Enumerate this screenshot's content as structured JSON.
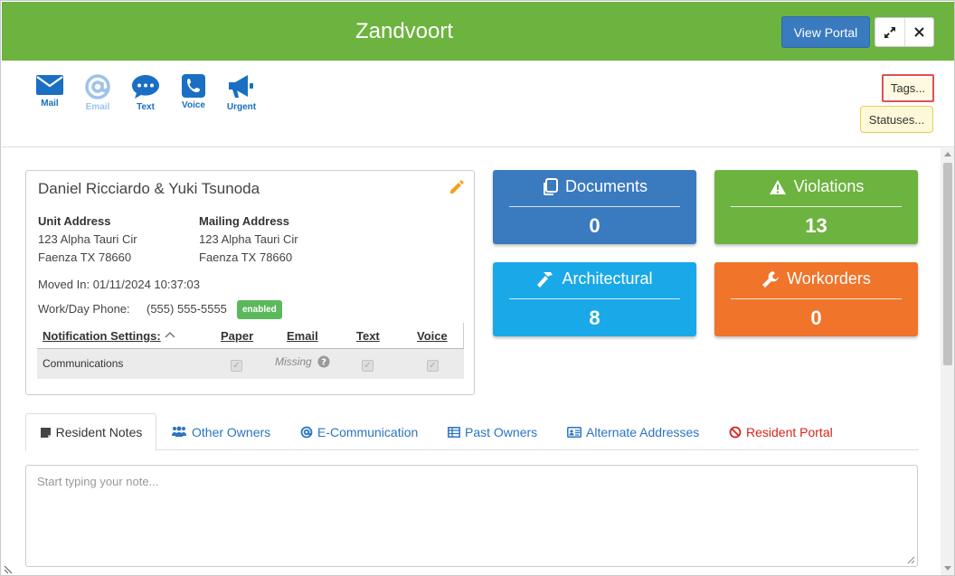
{
  "header": {
    "title": "Zandvoort",
    "view_portal_label": "View Portal"
  },
  "toolbar": {
    "items": [
      {
        "label": "Mail",
        "icon": "envelope-icon"
      },
      {
        "label": "Email",
        "icon": "at-icon"
      },
      {
        "label": "Text",
        "icon": "chat-bubble-icon"
      },
      {
        "label": "Voice",
        "icon": "phone-icon"
      },
      {
        "label": "Urgent",
        "icon": "megaphone-icon"
      }
    ],
    "tags_label": "Tags...",
    "statuses_label": "Statuses..."
  },
  "owner": {
    "name": "Daniel Ricciardo & Yuki Tsunoda",
    "unit_address_label": "Unit Address",
    "unit_address_line1": "123 Alpha Tauri Cir",
    "unit_address_line2": "Faenza TX 78660",
    "mailing_address_label": "Mailing Address",
    "mailing_address_line1": "123 Alpha Tauri Cir",
    "mailing_address_line2": "Faenza TX 78660",
    "moved_in": "Moved In: 01/11/2024 10:37:03",
    "phone_label": "Work/Day Phone:",
    "phone_value": "(555) 555-5555",
    "phone_badge": "enabled"
  },
  "notifications": {
    "header": "Notification Settings:",
    "columns": [
      "Paper",
      "Email",
      "Text",
      "Voice"
    ],
    "row_label": "Communications",
    "email_status": "Missing",
    "checkmark": "✓"
  },
  "tiles": {
    "documents": {
      "label": "Documents",
      "value": "0",
      "color": "#3a7abf"
    },
    "violations": {
      "label": "Violations",
      "value": "13",
      "color": "#6db33f"
    },
    "architectural": {
      "label": "Architectural",
      "value": "8",
      "color": "#1aa9e8"
    },
    "workorders": {
      "label": "Workorders",
      "value": "0",
      "color": "#f0742a"
    }
  },
  "tabs": [
    {
      "label": "Resident Notes",
      "icon": "note-icon"
    },
    {
      "label": "Other Owners",
      "icon": "users-icon"
    },
    {
      "label": "E-Communication",
      "icon": "at-icon"
    },
    {
      "label": "Past Owners",
      "icon": "table-icon"
    },
    {
      "label": "Alternate Addresses",
      "icon": "address-card-icon"
    },
    {
      "label": "Resident Portal",
      "icon": "ban-icon"
    }
  ],
  "notes": {
    "placeholder": "Start typing your note..."
  }
}
